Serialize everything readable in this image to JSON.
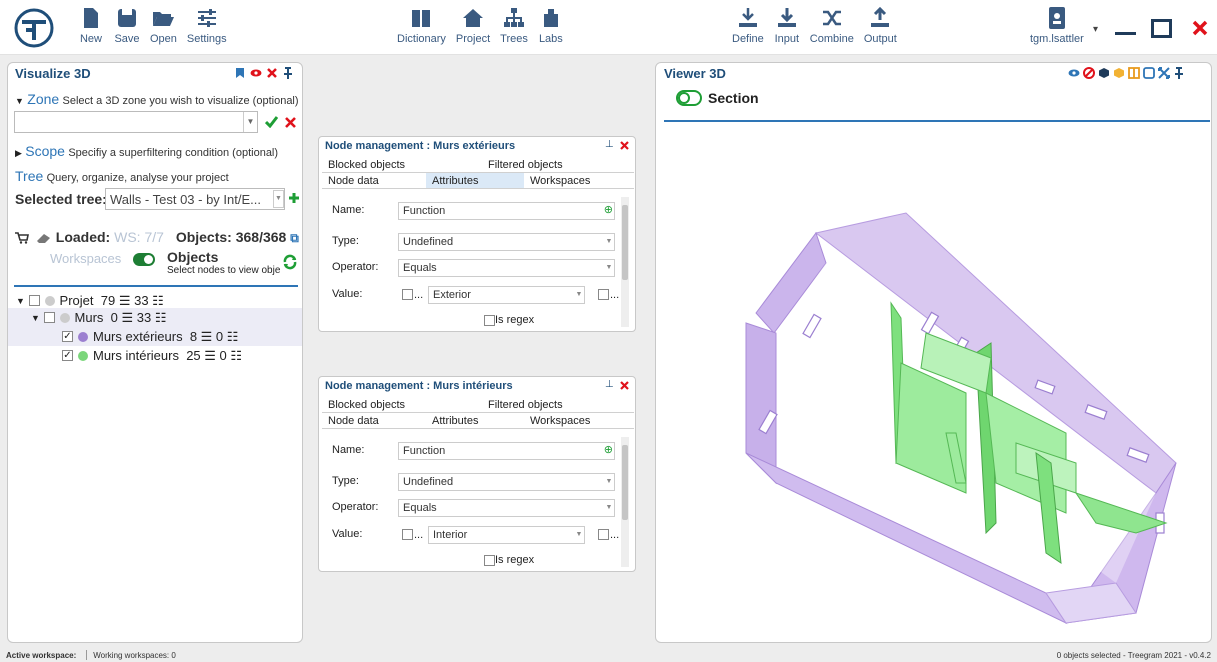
{
  "toolbar": {
    "file": [
      {
        "label": "New"
      },
      {
        "label": "Save"
      },
      {
        "label": "Open"
      },
      {
        "label": "Settings"
      }
    ],
    "nav": [
      {
        "label": "Dictionary"
      },
      {
        "label": "Project"
      },
      {
        "label": "Trees"
      },
      {
        "label": "Labs"
      }
    ],
    "actions": [
      {
        "label": "Define"
      },
      {
        "label": "Input"
      },
      {
        "label": "Combine"
      },
      {
        "label": "Output"
      }
    ],
    "user": "tgm.lsattler"
  },
  "visualize": {
    "title": "Visualize 3D",
    "zone_label": "Zone",
    "zone_hint": "Select a 3D zone you wish to visualize (optional)",
    "scope_label": "Scope",
    "scope_hint": "Specifiy a superfiltering condition (optional)",
    "tree_label": "Tree",
    "tree_hint": "Query, organize, analyse your project",
    "selected_tree_label": "Selected tree:",
    "selected_tree_value": "Walls - Test 03 - by Int/E...",
    "loaded_label": "Loaded:",
    "loaded_ws": "WS: 7/7",
    "objects_count": "Objects: 368/368",
    "workspaces_label": "Workspaces",
    "objects_toggle_label": "Objects",
    "objects_toggle_hint": "Select nodes to view obje",
    "tree": [
      {
        "label": "Projet",
        "counts": "79 ☰ 33 ☷"
      },
      {
        "label": "Murs",
        "counts": "0 ☰ 33 ☷"
      },
      {
        "label": "Murs extérieurs",
        "counts": "8 ☰ 0 ☷",
        "color": "#9b7fd0"
      },
      {
        "label": "Murs intérieurs",
        "counts": "25 ☰ 0 ☷",
        "color": "#7bd67b"
      }
    ]
  },
  "node_ext": {
    "title": "Node management : Murs extérieurs",
    "tab_blocked": "Blocked objects",
    "tab_filtered": "Filtered objects",
    "tab_node": "Node data",
    "tab_attributes": "Attributes",
    "tab_workspaces": "Workspaces",
    "name_label": "Name:",
    "name_value": "Function",
    "type_label": "Type:",
    "type_value": "Undefined",
    "operator_label": "Operator:",
    "operator_value": "Equals",
    "value_label": "Value:",
    "value_value": "Exterior",
    "ellipsis": "...",
    "regex_label": "Is regex"
  },
  "node_int": {
    "title": "Node management : Murs intérieurs",
    "tab_blocked": "Blocked objects",
    "tab_filtered": "Filtered objects",
    "tab_node": "Node data",
    "tab_attributes": "Attributes",
    "tab_workspaces": "Workspaces",
    "name_label": "Name:",
    "name_value": "Function",
    "type_label": "Type:",
    "type_value": "Undefined",
    "operator_label": "Operator:",
    "operator_value": "Equals",
    "value_label": "Value:",
    "value_value": "Interior",
    "ellipsis": "...",
    "regex_label": "Is regex"
  },
  "viewer": {
    "title": "Viewer 3D",
    "section_label": "Section"
  },
  "status": {
    "active_ws": "Active workspace:",
    "working_ws": "Working workspaces: 0",
    "right": "0 objects selected  -  Treegram 2021 - v0.4.2"
  },
  "colors": {
    "accent": "#2e75b6",
    "exterior": "#c9b3e8",
    "interior": "#8fe58f"
  }
}
